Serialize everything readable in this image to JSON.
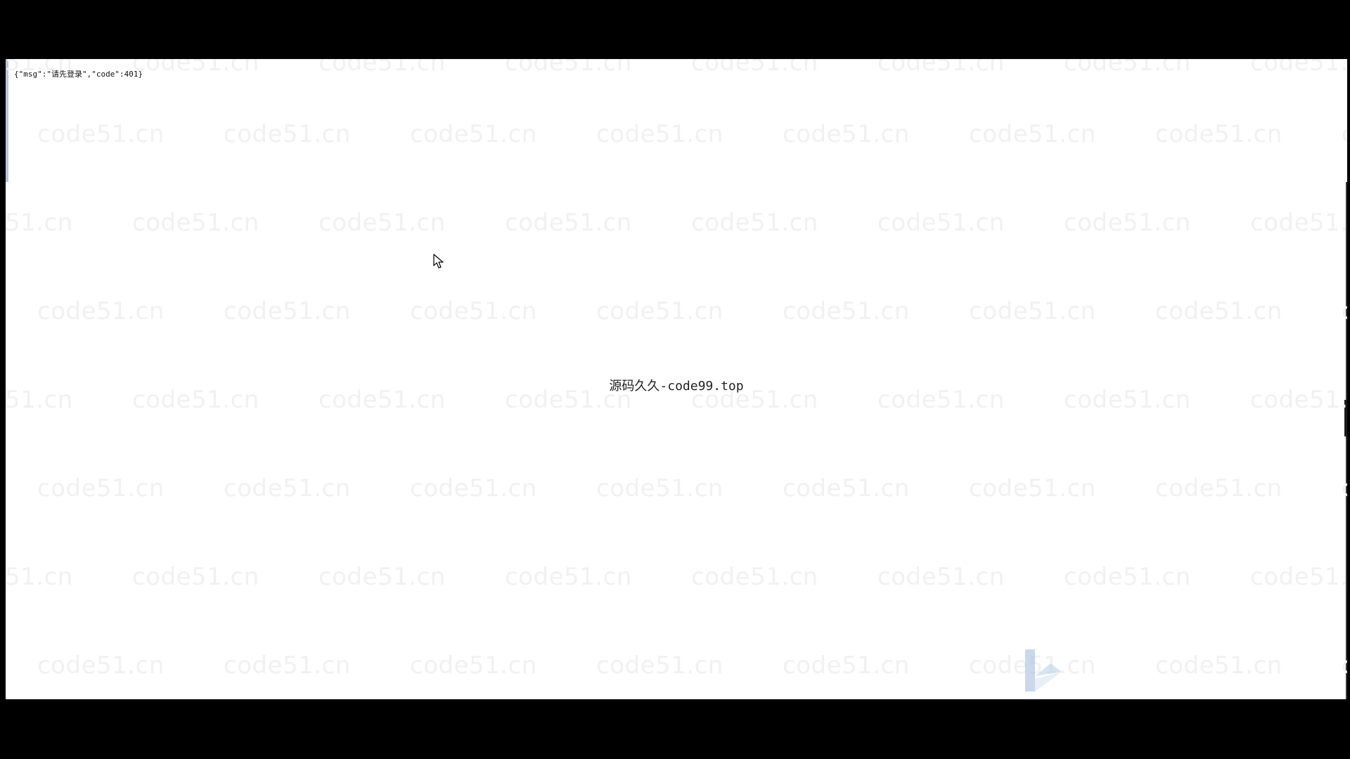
{
  "page": {
    "json_response": "{\"msg\":\"请先登录\",\"code\":401}",
    "center_caption": "源码久久-code99.top",
    "watermark_text": "code51.cn"
  },
  "icons": {
    "cursor": "mouse-pointer-icon",
    "corner_logo": "bilibili-style-corner-logo"
  },
  "colors": {
    "frame_background": "#000000",
    "page_background": "#ffffff",
    "watermark": "#f1f1f1",
    "text": "#111111"
  }
}
